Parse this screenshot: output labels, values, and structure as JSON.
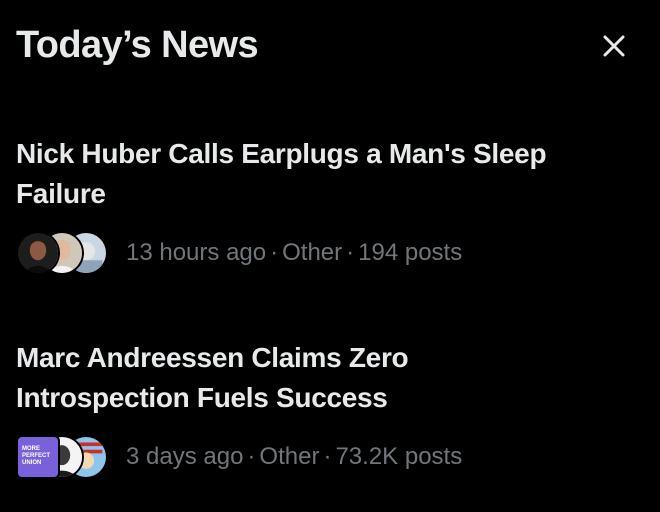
{
  "panel": {
    "title": "Today’s News",
    "close_icon": "close-icon"
  },
  "stories": [
    {
      "headline_line1": "Nick Huber Calls Earplugs a Man's Sleep",
      "headline_line2": "Failure",
      "time": "13 hours ago",
      "category": "Other",
      "posts": "194 posts",
      "separator": "·"
    },
    {
      "headline_line1": "Marc Andreessen Claims Zero",
      "headline_line2": "Introspection Fuels Success",
      "time": "3 days ago",
      "category": "Other",
      "posts": "73.2K posts",
      "separator": "·",
      "logo_text": "MORE PERFECT UNION"
    }
  ],
  "colors": {
    "background": "#000000",
    "text_primary": "#e7e9ea",
    "text_secondary": "#71767b",
    "logo_purple": "#7b61d9"
  }
}
